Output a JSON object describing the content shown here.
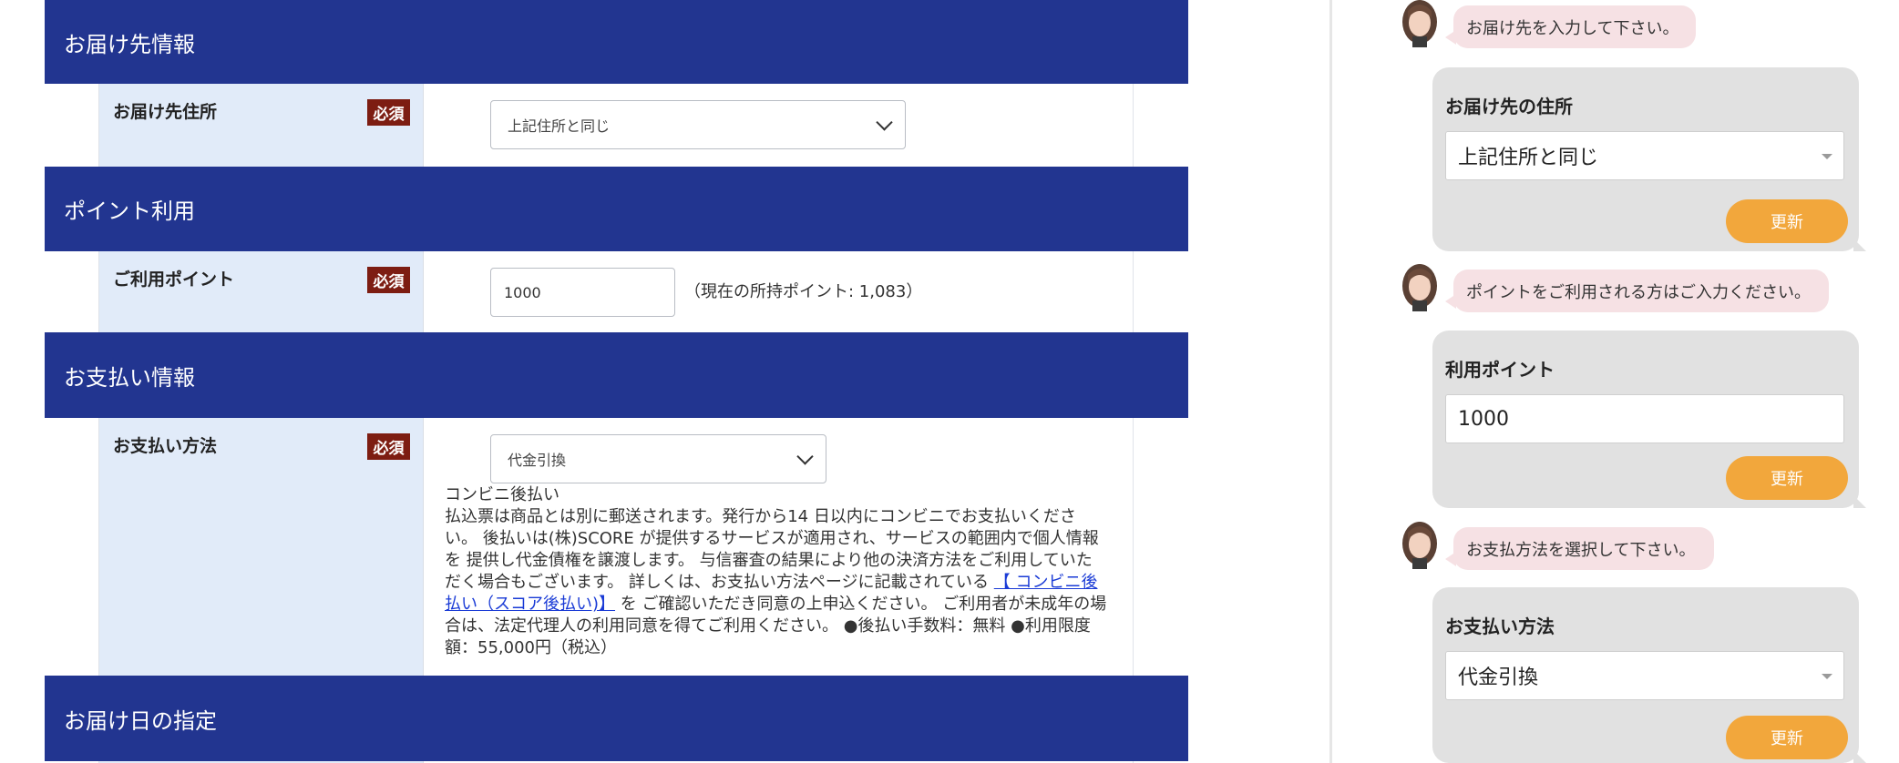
{
  "form": {
    "delivery_section": {
      "title": "お届け先情報"
    },
    "delivery_address": {
      "label": "お届け先住所",
      "required": "必須",
      "selected": "上記住所と同じ"
    },
    "points_section": {
      "title": "ポイント利用"
    },
    "points": {
      "label": "ご利用ポイント",
      "required": "必須",
      "value": "1000",
      "note": "（現在の所持ポイント: 1,083）"
    },
    "payment_section": {
      "title": "お支払い情報"
    },
    "payment": {
      "label": "お支払い方法",
      "required": "必須",
      "selected": "代金引換",
      "desc_title": "コンビニ後払い",
      "desc_body_1": "払込票は商品とは別に郵送されます。発行から14 日以内にコンビニでお支払いください。 後払いは(株)SCORE が提供するサービスが適用され、サービスの範囲内で個人情報を 提供し代金債権を譲渡します。 与信審査の結果により他の決済方法をご利用していただく場合もございます。 詳しくは、お支払い方法ページに記載されている ",
      "desc_link": "【 コンビニ後払い（スコア後払い)】",
      "desc_body_2": " を ご確認いただき同意の上申込ください。 ご利用者が未成年の場合は、法定代理人の利用同意を得てご利用ください。 ●後払い手数料：無料 ●利用限度額：55,000円（税込）"
    },
    "delivery_date_section": {
      "title": "お届け日の指定"
    }
  },
  "chat": {
    "msg_1": "お届け先を入力して下さい。",
    "card_1": {
      "title": "お届け先の住所",
      "value": "上記住所と同じ",
      "button": "更新"
    },
    "msg_2": "ポイントをご利用される方はご入力ください。",
    "card_2": {
      "title": "利用ポイント",
      "value": "1000",
      "button": "更新"
    },
    "msg_3": "お支払方法を選択して下さい。",
    "card_3": {
      "title": "お支払い方法",
      "value": "代金引換",
      "button": "更新"
    }
  },
  "colors": {
    "section_header": "#223590",
    "required_badge": "#7d1d12",
    "label_bg": "#e1ebf9",
    "update_button": "#f2a73c",
    "chat_bubble": "#f6e1e4"
  }
}
